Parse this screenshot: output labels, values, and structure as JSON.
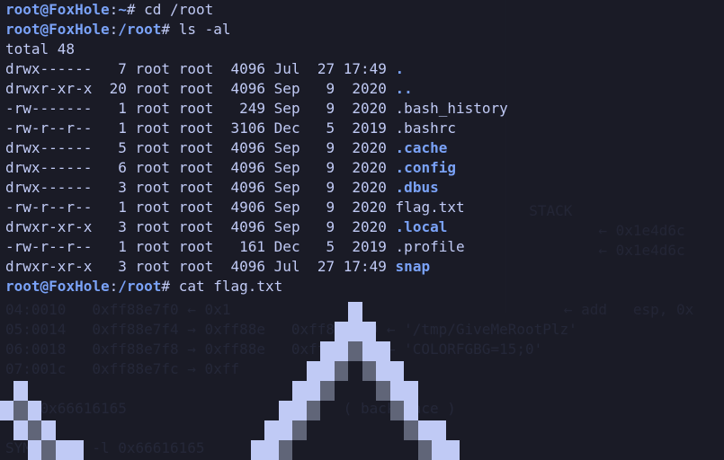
{
  "prompt": {
    "user": "root",
    "host": "FoxHole",
    "home_path": "~",
    "root_path": "/root",
    "sigil": "#"
  },
  "commands": {
    "cd": "cd /root",
    "ls": "ls -al",
    "cat": "cat flag.txt"
  },
  "total_line": "total 48",
  "listing": [
    {
      "perm": "drwx------",
      "links": "7",
      "owner": "root",
      "group": "root",
      "size": "4096",
      "month": "Jul",
      "day": "27",
      "time": "17:49",
      "name": ".",
      "dir": true
    },
    {
      "perm": "drwxr-xr-x",
      "links": "20",
      "owner": "root",
      "group": "root",
      "size": "4096",
      "month": "Sep",
      "day": "9",
      "time": "2020",
      "name": "..",
      "dir": true
    },
    {
      "perm": "-rw-------",
      "links": "1",
      "owner": "root",
      "group": "root",
      "size": "249",
      "month": "Sep",
      "day": "9",
      "time": "2020",
      "name": ".bash_history",
      "dir": false
    },
    {
      "perm": "-rw-r--r--",
      "links": "1",
      "owner": "root",
      "group": "root",
      "size": "3106",
      "month": "Dec",
      "day": "5",
      "time": "2019",
      "name": ".bashrc",
      "dir": false
    },
    {
      "perm": "drwx------",
      "links": "5",
      "owner": "root",
      "group": "root",
      "size": "4096",
      "month": "Sep",
      "day": "9",
      "time": "2020",
      "name": ".cache",
      "dir": true
    },
    {
      "perm": "drwx------",
      "links": "6",
      "owner": "root",
      "group": "root",
      "size": "4096",
      "month": "Sep",
      "day": "9",
      "time": "2020",
      "name": ".config",
      "dir": true
    },
    {
      "perm": "drwx------",
      "links": "3",
      "owner": "root",
      "group": "root",
      "size": "4096",
      "month": "Sep",
      "day": "9",
      "time": "2020",
      "name": ".dbus",
      "dir": true
    },
    {
      "perm": "-rw-r--r--",
      "links": "1",
      "owner": "root",
      "group": "root",
      "size": "4906",
      "month": "Sep",
      "day": "9",
      "time": "2020",
      "name": "flag.txt",
      "dir": false
    },
    {
      "perm": "drwxr-xr-x",
      "links": "3",
      "owner": "root",
      "group": "root",
      "size": "4096",
      "month": "Sep",
      "day": "9",
      "time": "2020",
      "name": ".local",
      "dir": true
    },
    {
      "perm": "-rw-r--r--",
      "links": "1",
      "owner": "root",
      "group": "root",
      "size": "161",
      "month": "Dec",
      "day": "5",
      "time": "2019",
      "name": ".profile",
      "dir": false
    },
    {
      "perm": "drwxr-xr-x",
      "links": "3",
      "owner": "root",
      "group": "root",
      "size": "4096",
      "month": "Jul",
      "day": "27",
      "time": "17:49",
      "name": "snap",
      "dir": true
    }
  ],
  "ghost": {
    "rows": [
      "04:0010   0xff88e7f0 ← 0x1",
      "05:0014   0xff88e7f4 → 0xff88e   0xff8903f9 ← '/tmp/GiveMeRootPlz'",
      "06:0018   0xff88e7f8 → 0xff88e   0xff89040c ← 'COLORFGBG=15;0'",
      "07:001c   0xff88e7fc → 0xff"
    ],
    "bt": "    0x66616165                         ( backtrace )",
    "sym": "SYMBOLic  -l 0x66616165"
  },
  "ghost_right": {
    "stack_label": "STACK",
    "rows": [
      "← 0x1e4d6c",
      "← 0x1e4d6c"
    ],
    "add": "← add   esp, 0x"
  },
  "banner_rows": [
    "0000000000000000000000000100000000000000000000000000",
    "0000000000000000000000001110000000000000000000000000",
    "0000000000000000000000011211000000000000000000000000",
    "0000000000000000000000112021100000000000000000000000",
    "0100000000000000000001120002110000000000000000000000",
    "1210000000000000000011200000210000000000000000000000",
    "0121000000000000000112000000021100000000000000000000",
    "0012110000000000001120000000002110000000000000000000"
  ],
  "fill_map": {
    "0": "s0",
    "1": "s1",
    "2": "s2",
    "3": "s3"
  }
}
